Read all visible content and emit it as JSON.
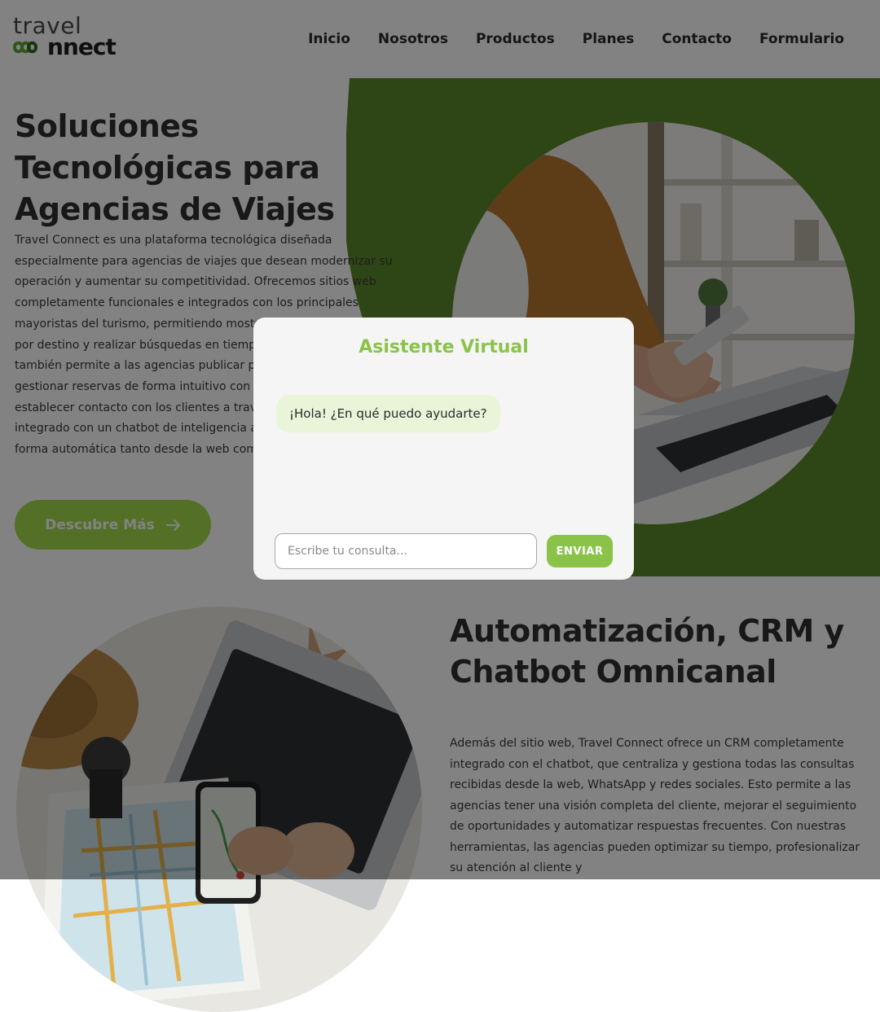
{
  "logo": {
    "line1": "travel",
    "line2": "nnect"
  },
  "nav": {
    "items": [
      "Inicio",
      "Nosotros",
      "Productos",
      "Planes",
      "Contacto",
      "Formulario"
    ]
  },
  "hero": {
    "title": "Soluciones Tecnológicas para Agencias de Viajes",
    "body": "Travel Connect es una plataforma tecnológica diseñada especialmente para agencias de viajes que desean modernizar su operación y aumentar su competitividad. Ofrecemos sitios web completamente funcionales e integrados con los principales mayoristas del turismo, permitiendo mostrar paquetes en tarjetas por destino y realizar búsquedas en tiempo real. Nuestra solución también permite a las agencias publicar paquetes personalizados, gestionar reservas de forma intuitivo con formularios modales, y establecer contacto con los clientes a través de WhatsApp, integrado con un chatbot de inteligencia artificial que responde de forma automática tanto desde la web como desde redes sociales.",
    "cta_label": "Descubre Más"
  },
  "section2": {
    "title": "Automatización, CRM y Chatbot Omnicanal",
    "body": "Además del sitio web, Travel Connect ofrece un CRM completamente integrado con el chatbot, que centraliza y gestiona todas las consultas recibidas desde la web, WhatsApp y redes sociales. Esto permite a las agencias tener una visión completa del cliente, mejorar el seguimiento de oportunidades y automatizar respuestas frecuentes. Con nuestras herramientas, las agencias pueden optimizar su tiempo, profesionalizar su atención al cliente y"
  },
  "chat": {
    "title": "Asistente Virtual",
    "greeting": "¡Hola! ¿En qué puedo ayudarte?",
    "input_placeholder": "Escribe tu consulta...",
    "input_value": "",
    "send_label": "ENVIAR"
  },
  "colors": {
    "brand_green": "#5a8a2a",
    "accent_green": "#8bc34a",
    "cta_green": "#a6dc4d",
    "bubble_green": "#e8f5d8"
  }
}
